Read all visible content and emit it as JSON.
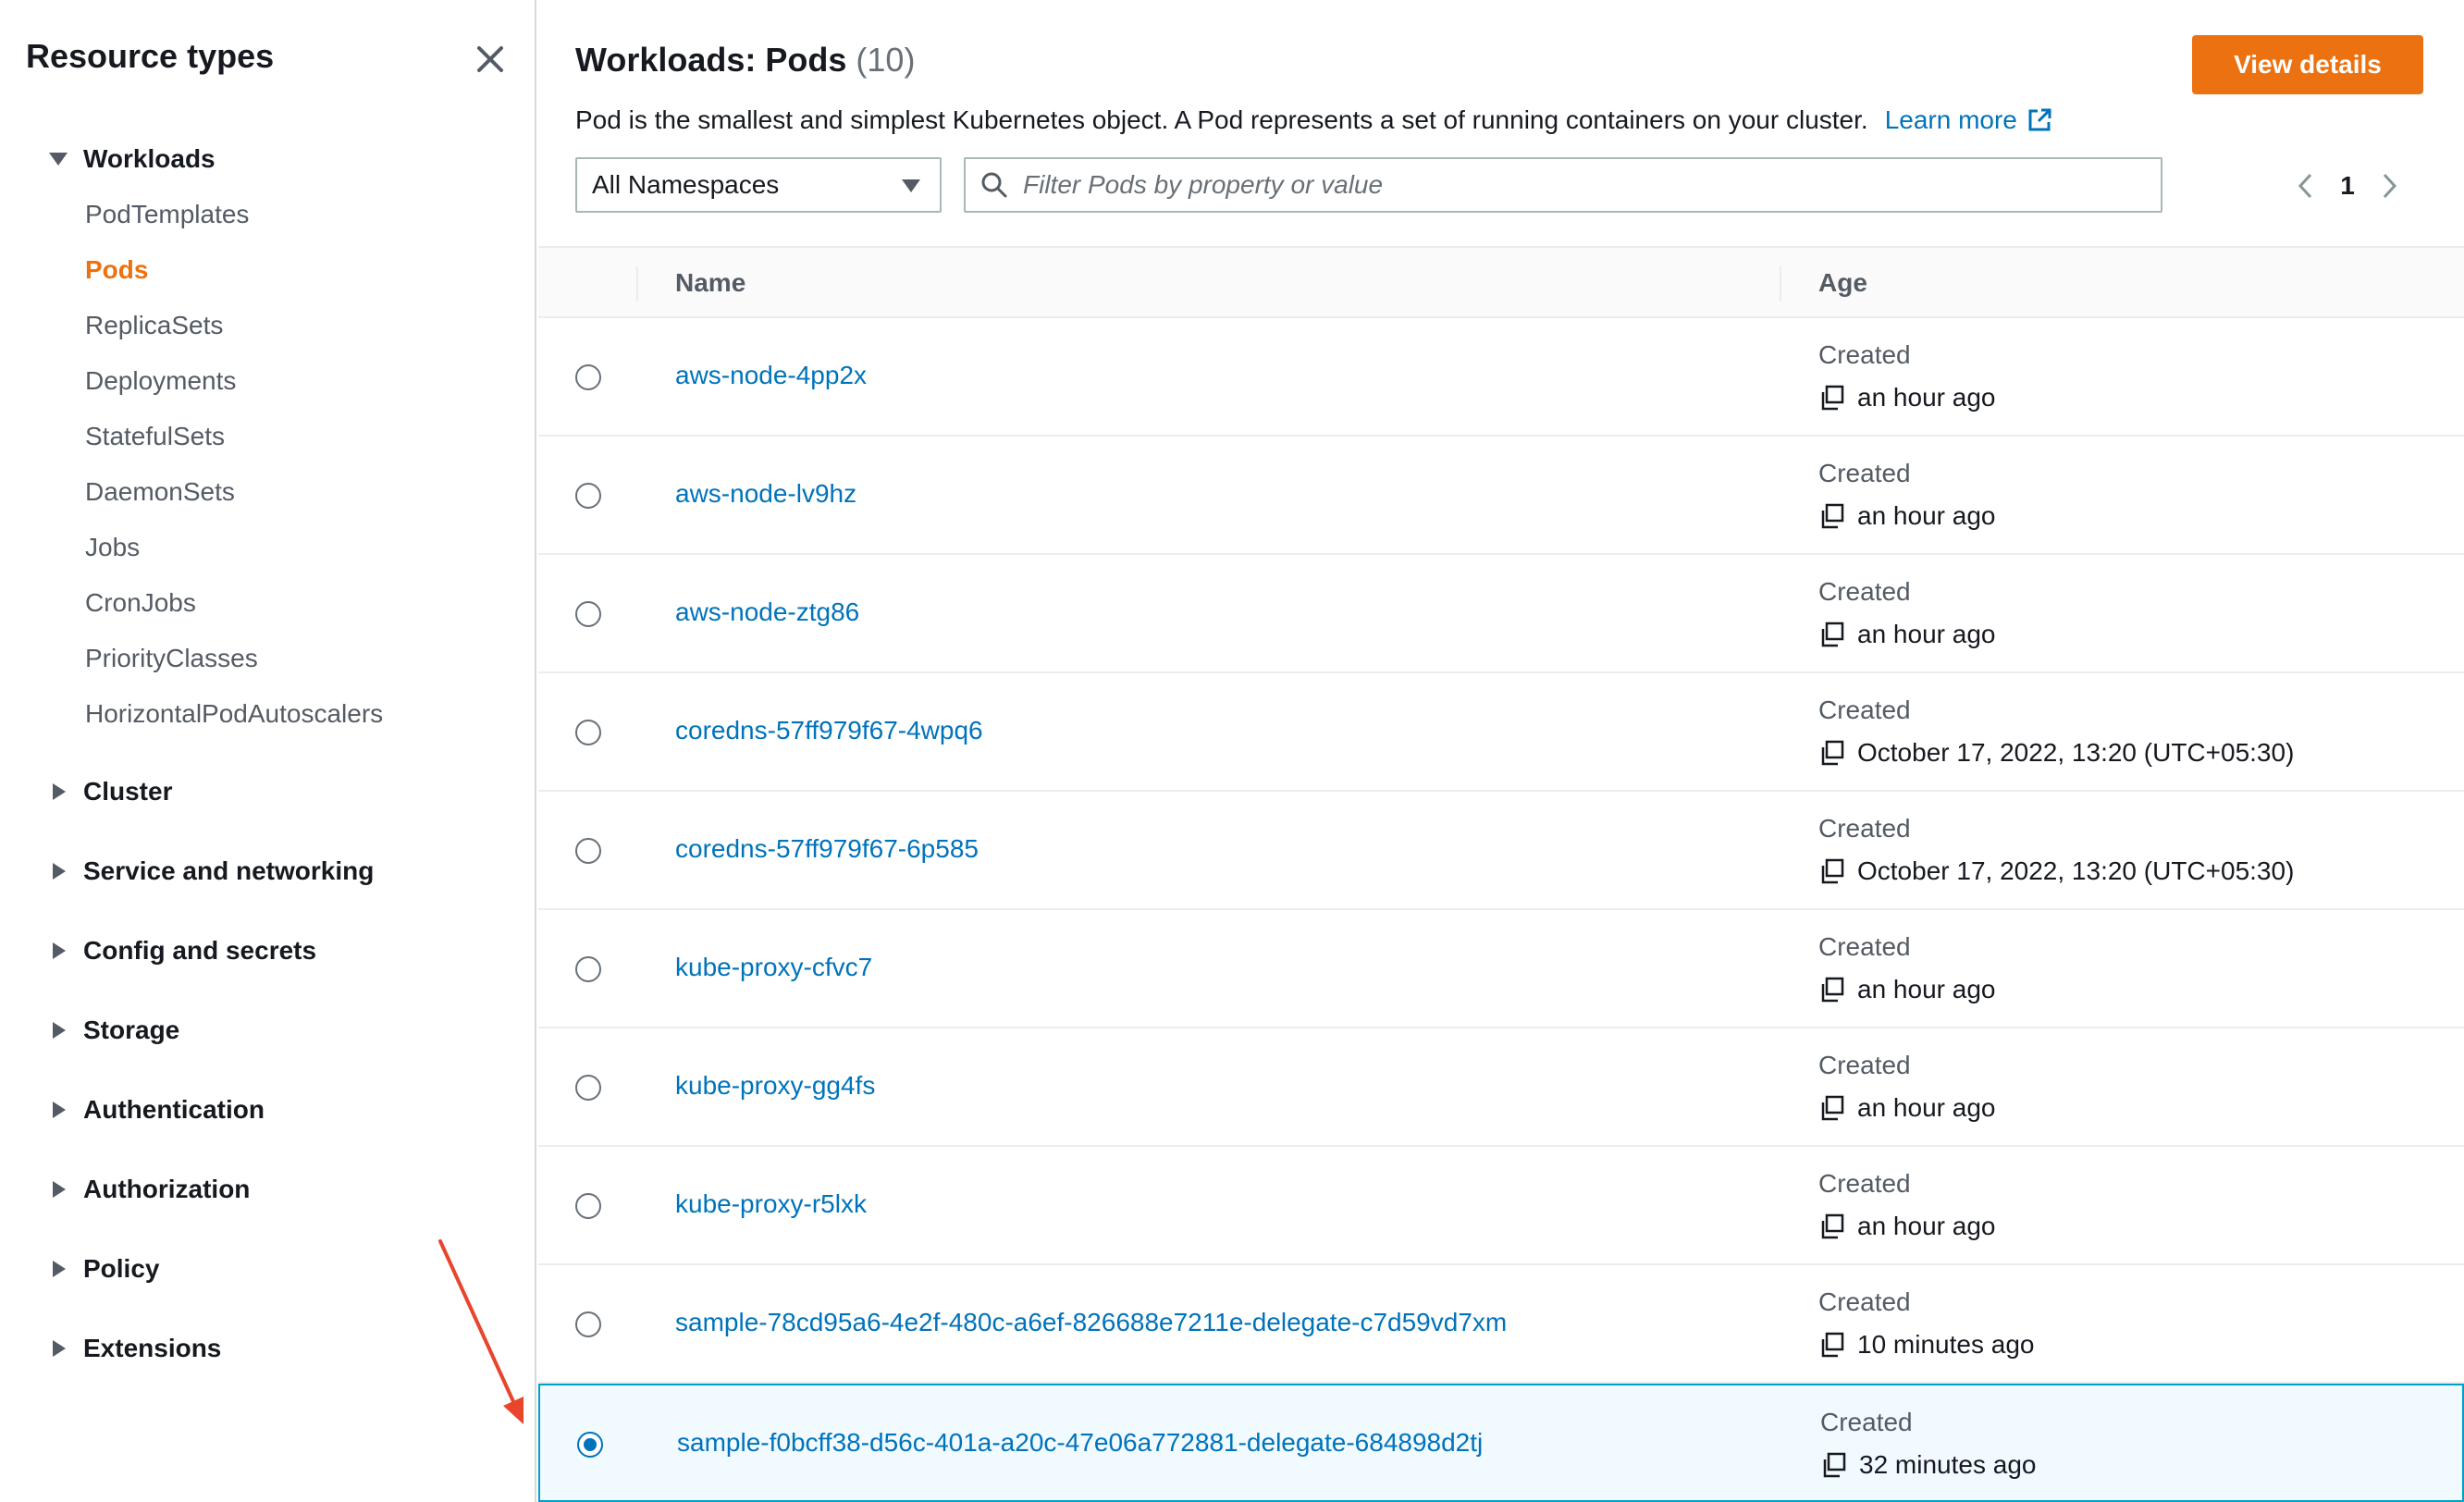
{
  "sidebar": {
    "title": "Resource types",
    "sections": [
      {
        "label": "Workloads",
        "expanded": true,
        "items": [
          {
            "label": "PodTemplates",
            "active": false
          },
          {
            "label": "Pods",
            "active": true
          },
          {
            "label": "ReplicaSets",
            "active": false
          },
          {
            "label": "Deployments",
            "active": false
          },
          {
            "label": "StatefulSets",
            "active": false
          },
          {
            "label": "DaemonSets",
            "active": false
          },
          {
            "label": "Jobs",
            "active": false
          },
          {
            "label": "CronJobs",
            "active": false
          },
          {
            "label": "PriorityClasses",
            "active": false
          },
          {
            "label": "HorizontalPodAutoscalers",
            "active": false
          }
        ]
      },
      {
        "label": "Cluster",
        "expanded": false
      },
      {
        "label": "Service and networking",
        "expanded": false
      },
      {
        "label": "Config and secrets",
        "expanded": false
      },
      {
        "label": "Storage",
        "expanded": false
      },
      {
        "label": "Authentication",
        "expanded": false
      },
      {
        "label": "Authorization",
        "expanded": false
      },
      {
        "label": "Policy",
        "expanded": false
      },
      {
        "label": "Extensions",
        "expanded": false
      }
    ]
  },
  "header": {
    "title": "Workloads: Pods",
    "count": "(10)",
    "view_details": "View details",
    "description": "Pod is the smallest and simplest Kubernetes object. A Pod represents a set of running containers on your cluster.",
    "learn_more": "Learn more"
  },
  "controls": {
    "namespace": "All Namespaces",
    "filter_placeholder": "Filter Pods by property or value",
    "page": "1"
  },
  "table": {
    "columns": [
      "Name",
      "Age"
    ],
    "rows": [
      {
        "name": "aws-node-4pp2x",
        "created_label": "Created",
        "age": "an hour ago",
        "selected": false
      },
      {
        "name": "aws-node-lv9hz",
        "created_label": "Created",
        "age": "an hour ago",
        "selected": false
      },
      {
        "name": "aws-node-ztg86",
        "created_label": "Created",
        "age": "an hour ago",
        "selected": false
      },
      {
        "name": "coredns-57ff979f67-4wpq6",
        "created_label": "Created",
        "age": "October 17, 2022, 13:20 (UTC+05:30)",
        "selected": false
      },
      {
        "name": "coredns-57ff979f67-6p585",
        "created_label": "Created",
        "age": "October 17, 2022, 13:20 (UTC+05:30)",
        "selected": false
      },
      {
        "name": "kube-proxy-cfvc7",
        "created_label": "Created",
        "age": "an hour ago",
        "selected": false
      },
      {
        "name": "kube-proxy-gg4fs",
        "created_label": "Created",
        "age": "an hour ago",
        "selected": false
      },
      {
        "name": "kube-proxy-r5lxk",
        "created_label": "Created",
        "age": "an hour ago",
        "selected": false
      },
      {
        "name": "sample-78cd95a6-4e2f-480c-a6ef-826688e7211e-delegate-c7d59vd7xm",
        "created_label": "Created",
        "age": "10 minutes ago",
        "selected": false
      },
      {
        "name": "sample-f0bcff38-d56c-401a-a20c-47e06a772881-delegate-684898d2tj",
        "created_label": "Created",
        "age": "32 minutes ago",
        "selected": true
      }
    ]
  },
  "colors": {
    "accent": "#ec7211",
    "link": "#0073bb",
    "selected_border": "#00a1c9",
    "selected_bg": "#f1faff",
    "annotation_arrow": "#e8452c"
  }
}
